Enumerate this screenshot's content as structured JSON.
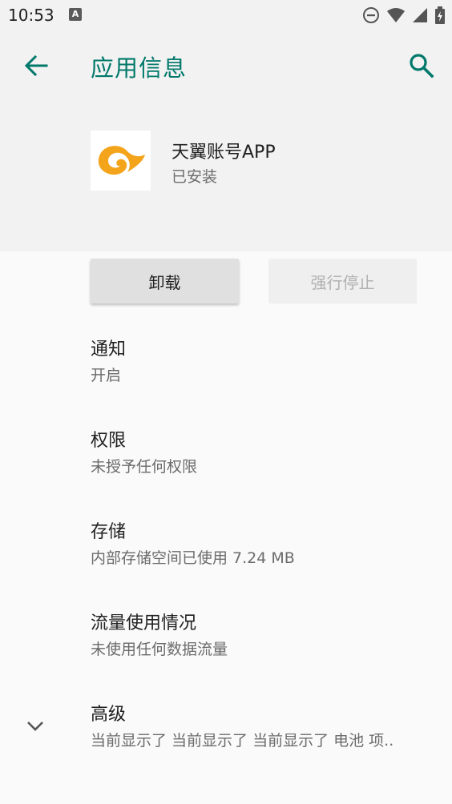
{
  "status_bar": {
    "time": "10:53",
    "notification_badge": "A",
    "icons": [
      "dnd-icon",
      "wifi-icon",
      "signal-icon",
      "battery-icon"
    ]
  },
  "appbar": {
    "title": "应用信息",
    "back_icon": "arrow-back-icon",
    "search_icon": "search-icon"
  },
  "app": {
    "name": "天翼账号APP",
    "status": "已安装",
    "icon_color": "#f4a41b"
  },
  "buttons": {
    "uninstall": "卸载",
    "force_stop": "强行停止"
  },
  "items": [
    {
      "title": "通知",
      "subtitle": "开启"
    },
    {
      "title": "权限",
      "subtitle": "未授予任何权限"
    },
    {
      "title": "存储",
      "subtitle": "内部存储空间已使用 7.24 MB"
    },
    {
      "title": "流量使用情况",
      "subtitle": "未使用任何数据流量"
    },
    {
      "title": "高级",
      "subtitle": "当前显示了 当前显示了 当前显示了 电池 项.."
    }
  ],
  "colors": {
    "accent": "#00796b",
    "header_bg": "#f2f2f2",
    "content_bg": "#fafafa"
  }
}
